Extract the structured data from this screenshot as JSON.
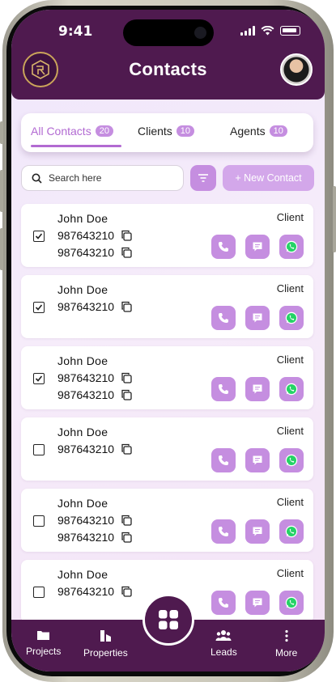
{
  "status_bar": {
    "time": "9:41"
  },
  "header": {
    "title": "Contacts"
  },
  "tabs": [
    {
      "label": "All Contacts",
      "count": "20",
      "active": true
    },
    {
      "label": "Clients",
      "count": "10",
      "active": false
    },
    {
      "label": "Agents",
      "count": "10",
      "active": false
    }
  ],
  "search": {
    "placeholder": "Search here"
  },
  "new_contact_label": "+ New Contact",
  "contacts": [
    {
      "name": "John Doe",
      "phones": [
        "987643210",
        "987643210"
      ],
      "type": "Client",
      "checked": true
    },
    {
      "name": "John Doe",
      "phones": [
        "987643210"
      ],
      "type": "Client",
      "checked": true
    },
    {
      "name": "John Doe",
      "phones": [
        "987643210",
        "987643210"
      ],
      "type": "Client",
      "checked": true
    },
    {
      "name": "John Doe",
      "phones": [
        "987643210"
      ],
      "type": "Client",
      "checked": false
    },
    {
      "name": "John Doe",
      "phones": [
        "987643210",
        "987643210"
      ],
      "type": "Client",
      "checked": false
    },
    {
      "name": "John Doe",
      "phones": [
        "987643210"
      ],
      "type": "Client",
      "checked": false
    }
  ],
  "bottom_nav": [
    {
      "label": "Projects",
      "icon": "folder-icon"
    },
    {
      "label": "Properties",
      "icon": "buildings-icon"
    },
    {
      "label": "Leads",
      "icon": "people-icon"
    },
    {
      "label": "More",
      "icon": "more-vertical-icon"
    }
  ],
  "colors": {
    "primary": "#4f1a4f",
    "accent": "#c58ee0",
    "active_tab": "#b26ad2"
  }
}
